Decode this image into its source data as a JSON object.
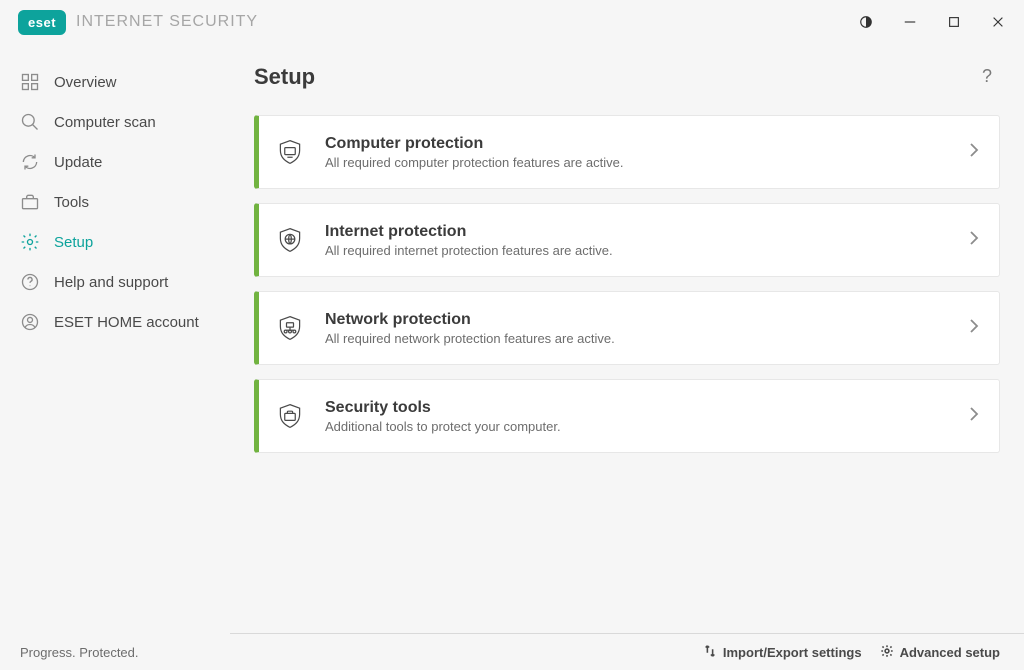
{
  "header": {
    "brand": "eset",
    "product": "INTERNET SECURITY"
  },
  "sidebar": {
    "items": [
      {
        "label": "Overview"
      },
      {
        "label": "Computer scan"
      },
      {
        "label": "Update"
      },
      {
        "label": "Tools"
      },
      {
        "label": "Setup"
      },
      {
        "label": "Help and support"
      },
      {
        "label": "ESET HOME account"
      }
    ]
  },
  "main": {
    "title": "Setup",
    "cards": [
      {
        "title": "Computer protection",
        "subtitle": "All required computer protection features are active."
      },
      {
        "title": "Internet protection",
        "subtitle": "All required internet protection features are active."
      },
      {
        "title": "Network protection",
        "subtitle": "All required network protection features are active."
      },
      {
        "title": "Security tools",
        "subtitle": "Additional tools to protect your computer."
      }
    ]
  },
  "footer": {
    "tagline": "Progress. Protected.",
    "import_export": "Import/Export settings",
    "advanced": "Advanced setup"
  }
}
